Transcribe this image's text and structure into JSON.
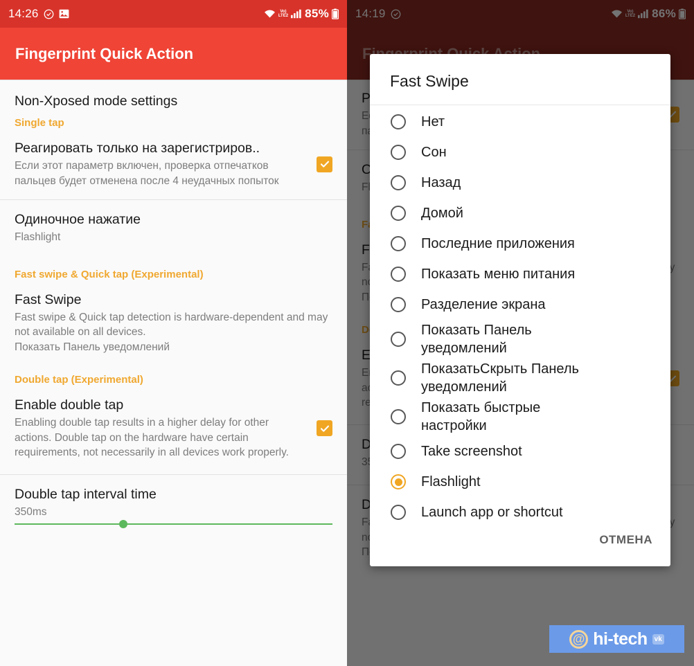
{
  "left_screen": {
    "statusbar": {
      "time": "14:26",
      "battery": "85%",
      "network": "LTE2",
      "volte": "Vo)"
    },
    "appbar": {
      "title": "Fingerprint Quick Action"
    },
    "header": {
      "label": "Non-Xposed mode settings"
    },
    "categories": {
      "single_tap": "Single tap",
      "fast_swipe": "Fast swipe & Quick tap (Experimental)",
      "double_tap": "Double tap (Experimental)"
    },
    "items": [
      {
        "title": "Реагировать только на зарегистриров..",
        "summary": "Если этот параметр включен, проверка отпечатков пальцев будет отменена после 4 неудачных попыток",
        "checked": true
      },
      {
        "title": "Одиночное нажатие",
        "summary": "Flashlight",
        "checked": false
      },
      {
        "title": "Fast Swipe",
        "summary": "Fast swipe & Quick tap detection is hardware-dependent and may not available on all devices.\nПоказать Панель уведомлений",
        "checked": false
      },
      {
        "title": "Enable double tap",
        "summary": "Enabling double tap results in a higher delay for other actions. Double tap on the hardware have certain requirements, not necessarily in all devices work properly.",
        "checked": true
      },
      {
        "title": "Double tap interval time",
        "summary": "350ms",
        "checked": false
      }
    ]
  },
  "right_screen": {
    "statusbar": {
      "time": "14:19",
      "battery": "86%",
      "network": "LTE2",
      "volte": "Vo)"
    },
    "appbar": {
      "title": "Fingerprint Quick Action"
    },
    "dialog": {
      "title": "Fast Swipe",
      "selected_index": 12,
      "options": [
        "Нет",
        "Сон",
        "Назад",
        "Домой",
        "Последние приложения",
        "Показать меню питания",
        "Разделение экрана",
        "Показать Панель уведомлений",
        "ПоказатьСкрыть Панель уведомлений",
        "Показать быстрые настройки",
        "Take screenshot",
        "Flashlight",
        "Launch app or shortcut"
      ],
      "cancel_label": "ОТМЕНА"
    }
  },
  "watermark": {
    "text": "hi-tech",
    "badge": "vk",
    "at": "@"
  },
  "colors": {
    "statusbar_red": "#d8332a",
    "appbar_red": "#ef4436",
    "accent_orange": "#f0a623",
    "category_orange": "#f0a830",
    "slider_green": "#5cb85c",
    "watermark_blue": "#6b9ae8"
  }
}
